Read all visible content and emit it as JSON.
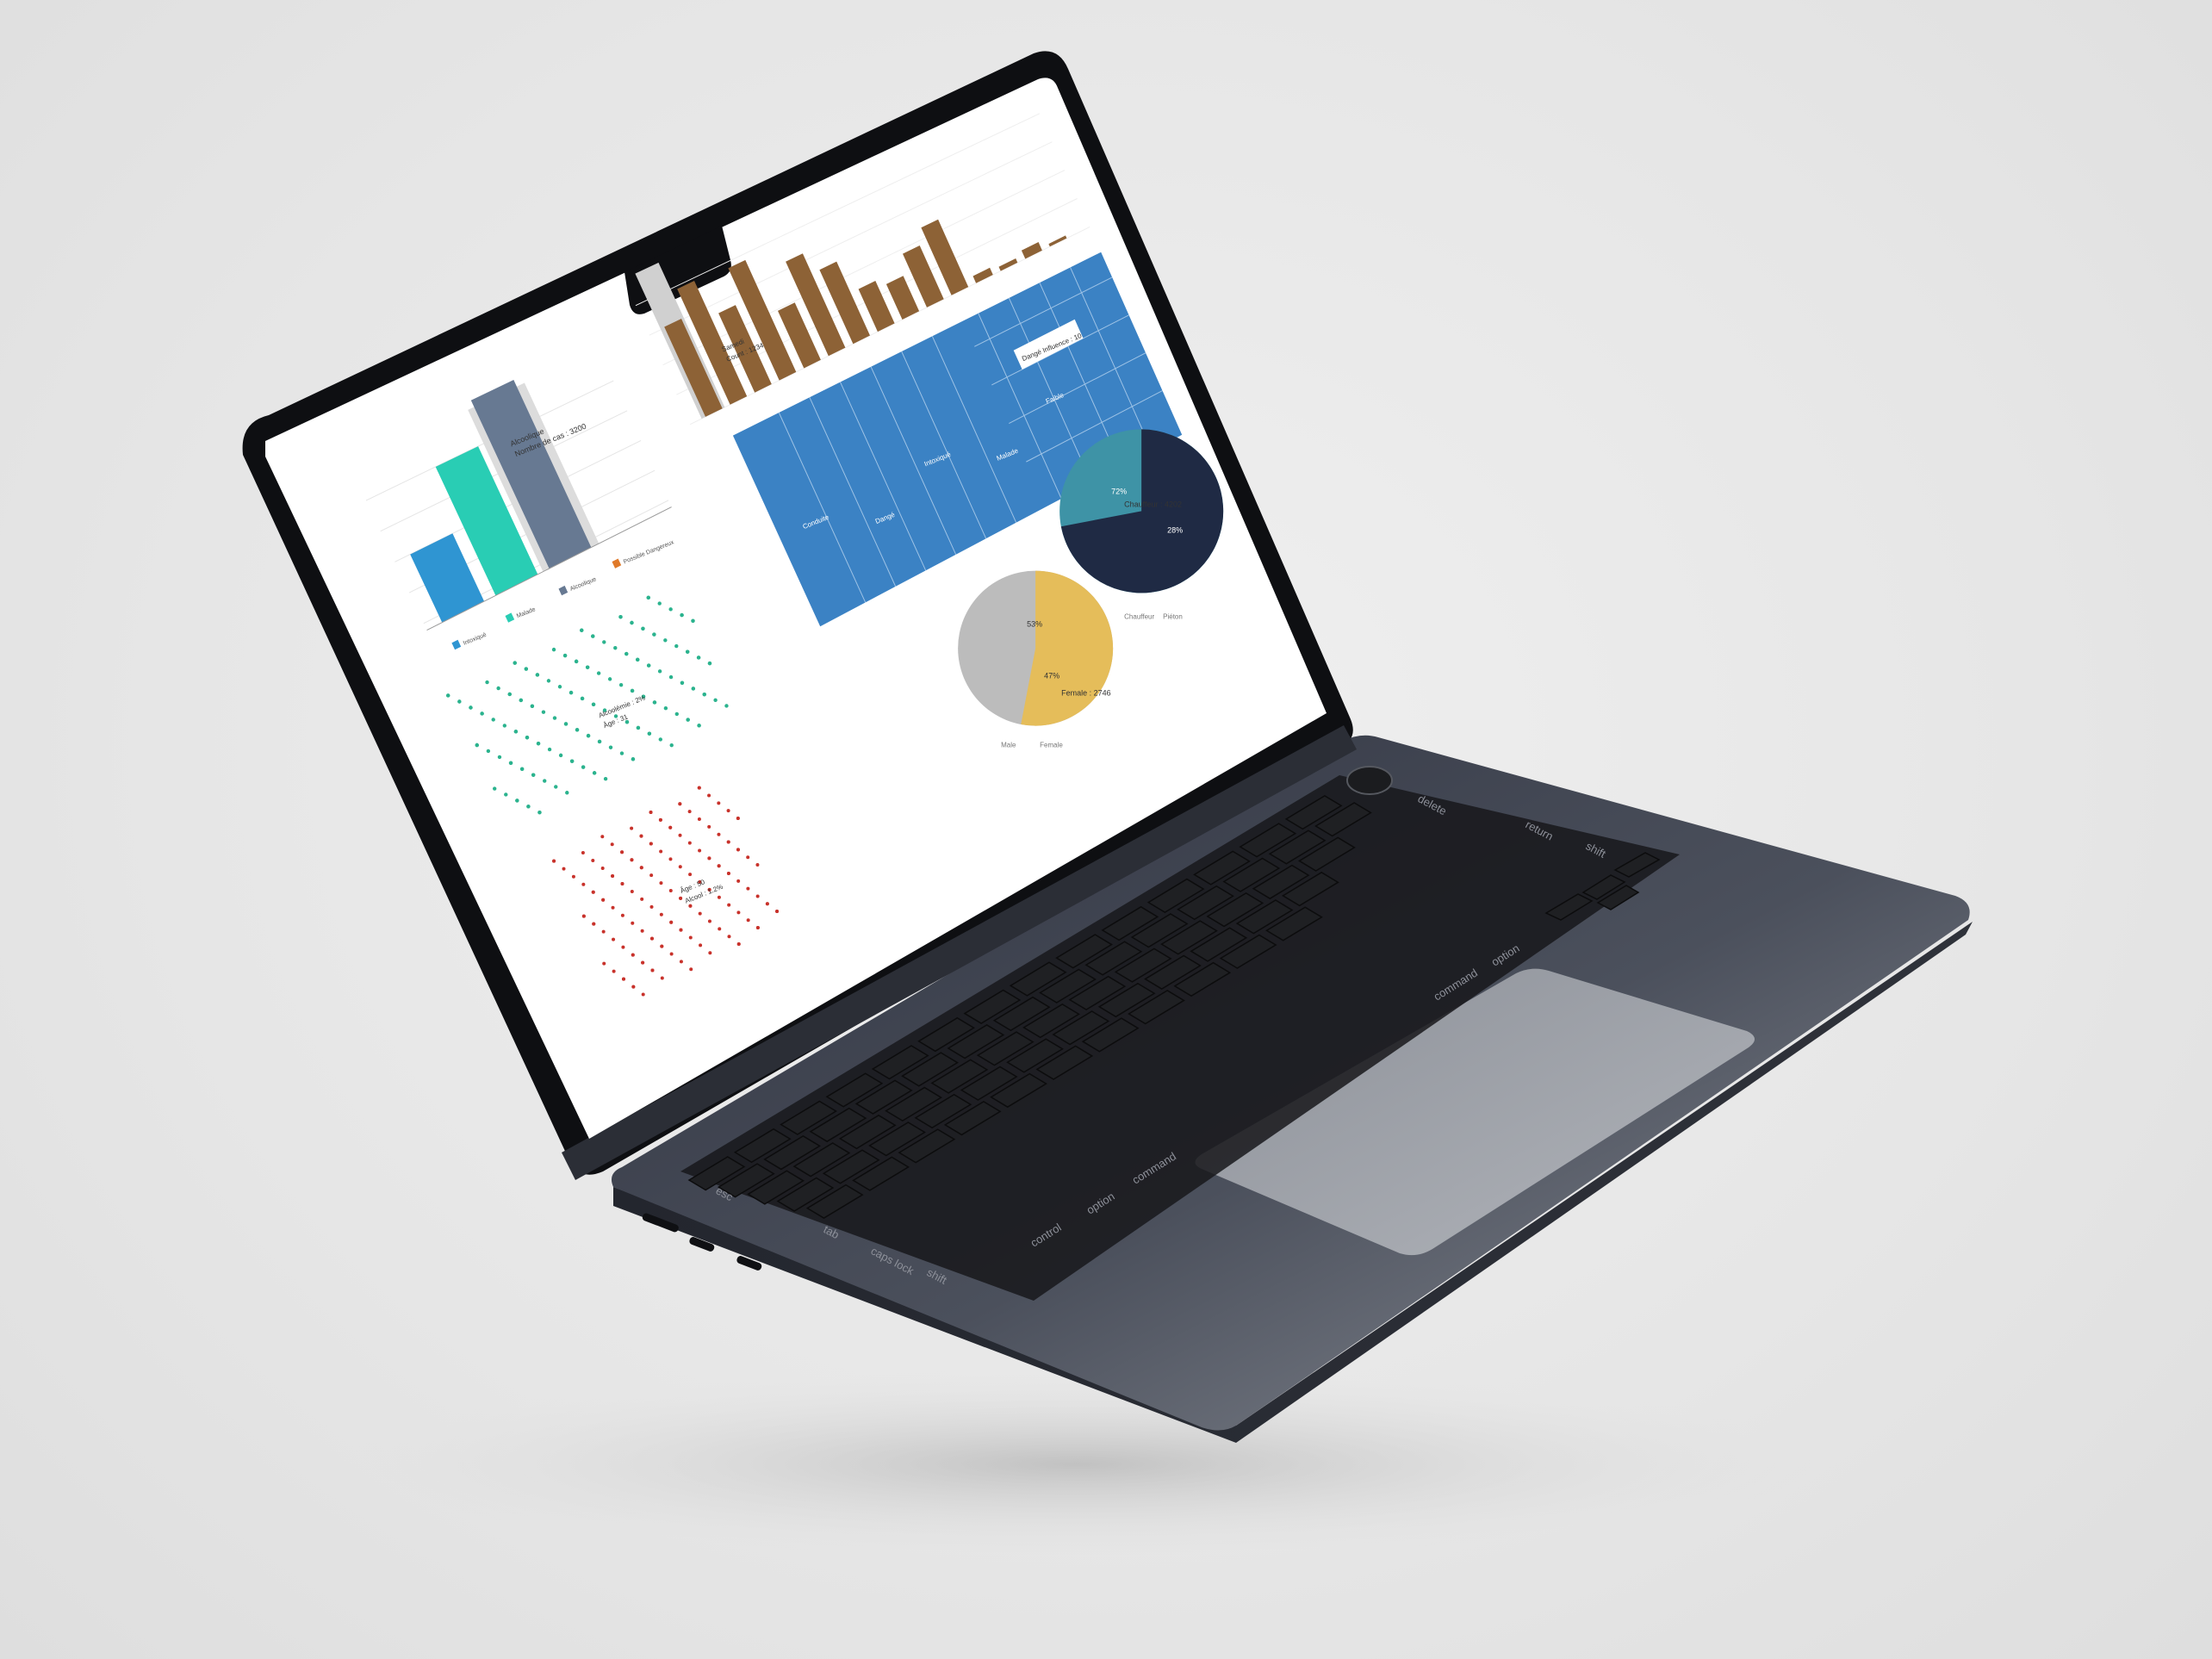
{
  "colors": {
    "bar_blue": "#2f95d2",
    "bar_teal": "#29cdb4",
    "bar_slate": "#677992",
    "bar_orange": "#e07a2a",
    "brown": "#8d6236",
    "treemap_blue": "#3b82c4",
    "gold": "#e5bd5a",
    "grey": "#bcbcbc",
    "navy": "#1f2a44",
    "teal_slice": "#3e93a6",
    "scatter_green": "#2bb38e",
    "scatter_red": "#c8322b"
  },
  "charts": {
    "top_bar": {
      "tooltip_line1": "Alcoolique",
      "tooltip_line2": "Nombre de cas : 3200",
      "legend": [
        "Intoxiqué",
        "Malade",
        "Alcoolique",
        "Possible Dangereux"
      ]
    },
    "brown_bar": {
      "tooltip_line1": "Samedi",
      "tooltip_line2": "Count : 1234"
    },
    "treemap": {
      "tooltip": "Dangé Influence : 10",
      "labels": [
        "Conduite",
        "Dangé",
        "Intoxiqué",
        "Malade",
        "Faible"
      ]
    },
    "pie_gender": {
      "pct_a": "53%",
      "pct_b": "47%",
      "tooltip": "Female : 2746",
      "legend": [
        "Male",
        "Female"
      ]
    },
    "pie_group": {
      "pct_a": "72%",
      "pct_b": "28%",
      "tooltip": "Chauffeur : 4202",
      "legend": [
        "Chauffeur",
        "Piéton"
      ]
    },
    "scatter_green": {
      "tooltip_line1": "Alcoolémie : 2%",
      "tooltip_line2": "Âge : 31"
    },
    "scatter_red": {
      "tooltip_line1": "Âge : 50",
      "tooltip_line2": "Alcool : 1.2%"
    }
  },
  "keyboard": {
    "esc": "esc",
    "tab": "tab",
    "caps": "caps lock",
    "shift_left": "shift",
    "control": "control",
    "option_left": "option",
    "command_left": "command",
    "command_right": "command",
    "option_right": "option",
    "return": "return",
    "shift_right": "shift",
    "delete": "delete",
    "cmd_symbol": "⌘"
  }
}
